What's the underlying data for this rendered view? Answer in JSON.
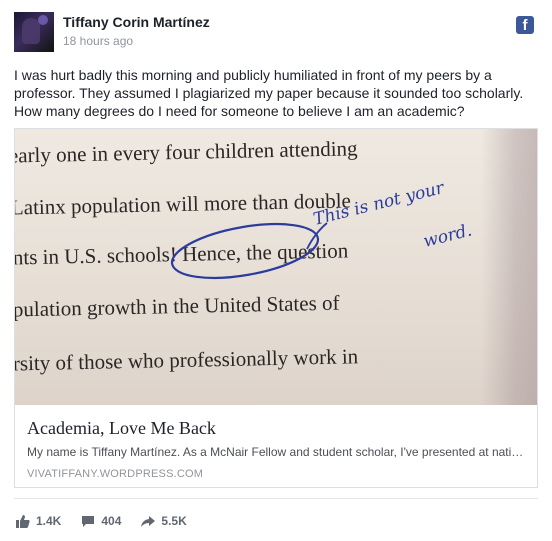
{
  "post": {
    "author": "Tiffany Corin Martínez",
    "timestamp": "18 hours ago",
    "text": "I was hurt badly this morning and publicly humiliated in front of my peers by a professor. They assumed I plagiarized my paper because it sounded too scholarly. How many degrees do I need for someone to believe I am an academic?"
  },
  "photo": {
    "lines": [
      "early one in every four children attending",
      "Latinx population will more than double",
      "nts in U.S. schools! Hence, the question",
      "pulation growth in the United States of",
      "rsity of those who professionally work in"
    ],
    "annotation": [
      "This is not your",
      "word."
    ]
  },
  "link_card": {
    "title": "Academia, Love Me Back",
    "description": "My name is Tiffany Martínez. As a McNair Fellow and student scholar, I've presented at nati…",
    "domain": "VIVATIFFANY.WORDPRESS.COM"
  },
  "reactions": {
    "likes": "1.4K",
    "comments": "404",
    "shares": "5.5K"
  },
  "icons": [
    "avatar",
    "facebook-icon",
    "like-icon",
    "comment-icon",
    "share-icon"
  ],
  "colors": {
    "facebook_blue": "#3b5998",
    "ink_blue": "#2a3c9c"
  }
}
